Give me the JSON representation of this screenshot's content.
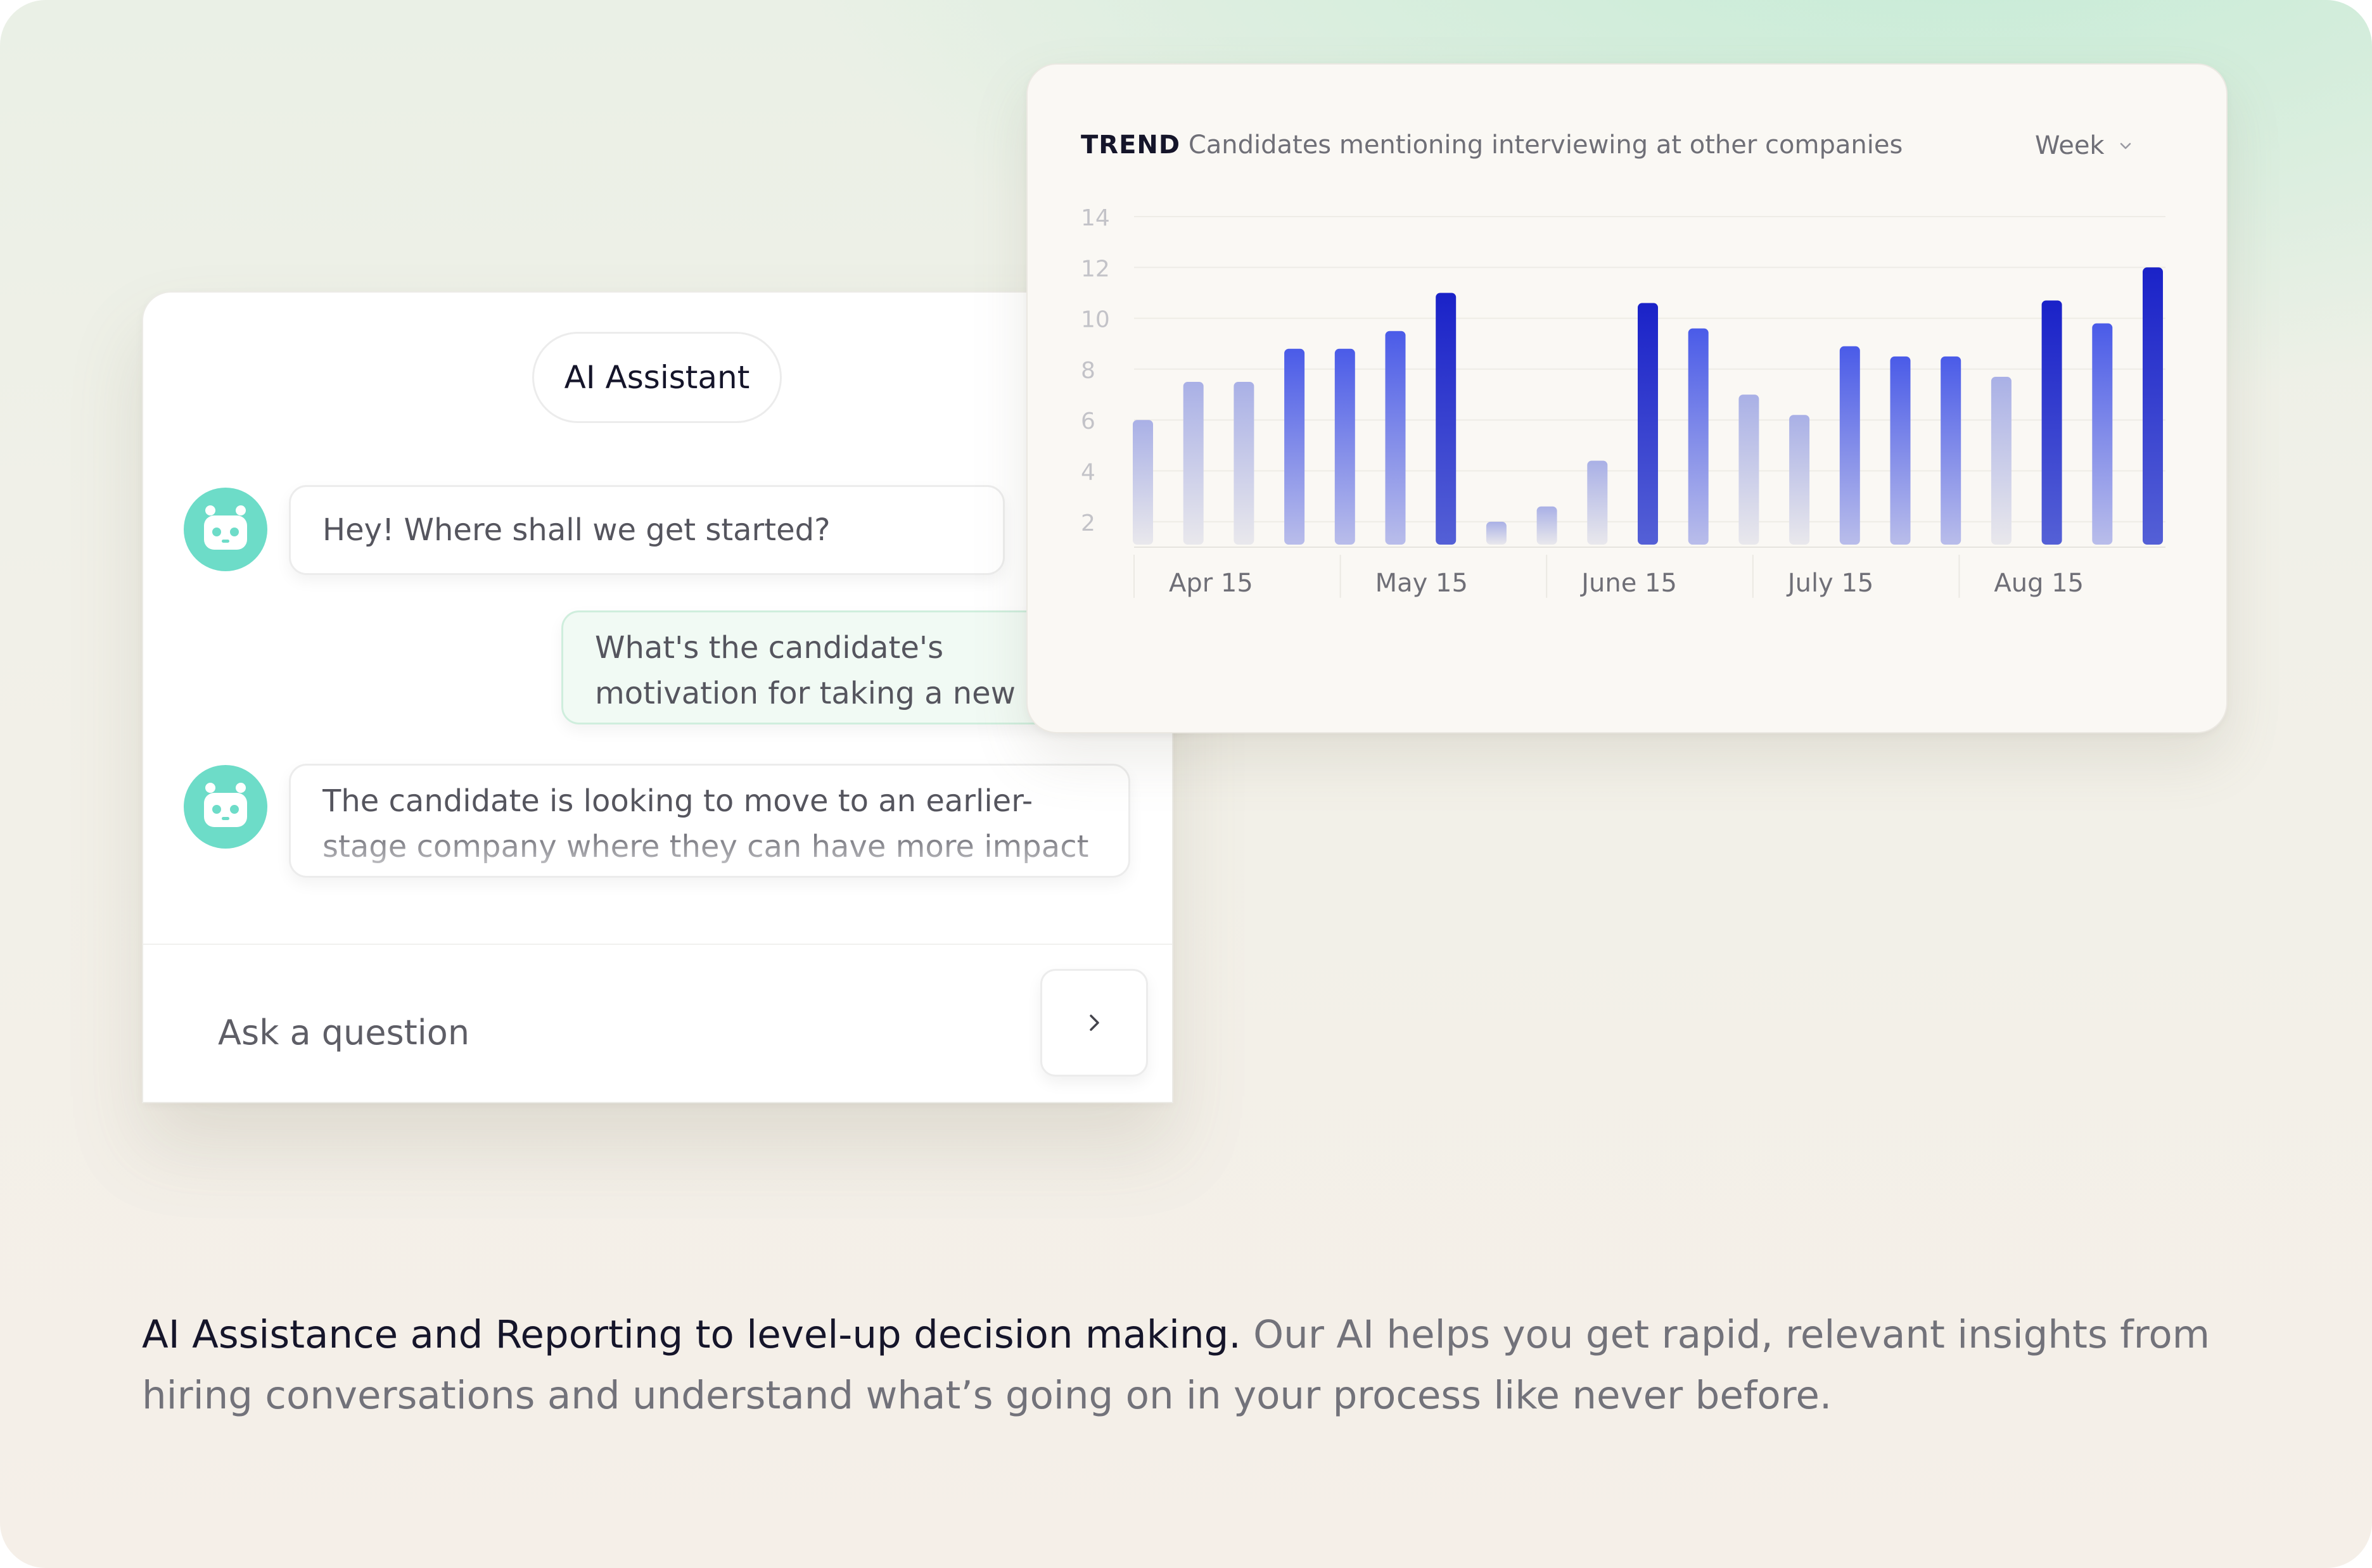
{
  "chat": {
    "title": "AI Assistant",
    "messages": [
      {
        "role": "assistant",
        "text": "Hey! Where shall we get started?"
      },
      {
        "role": "user",
        "line1": "What's the candidate's",
        "line2": "motivation for taking a new r"
      },
      {
        "role": "assistant",
        "line1": "The candidate is looking to move to an earlier-",
        "line2": "stage company where they can have more impact"
      }
    ],
    "input_placeholder": "Ask a question",
    "avatar_icon": "robot-icon",
    "send_icon": "chevron-right-icon"
  },
  "trend": {
    "label": "TREND",
    "title": "Candidates mentioning interviewing at other companies",
    "period": "Week",
    "period_icon": "chevron-down-icon"
  },
  "chart_data": {
    "type": "bar",
    "title": "Candidates mentioning interviewing at other companies",
    "xlabel": "",
    "ylabel": "",
    "ylim": [
      1,
      14
    ],
    "yticks": [
      2,
      4,
      6,
      8,
      10,
      12,
      14
    ],
    "xticks": [
      "Apr 15",
      "May 15",
      "June 15",
      "July 15",
      "Aug 15"
    ],
    "grid": true,
    "values": [
      6,
      7.5,
      7.5,
      8.8,
      8.8,
      9.5,
      11,
      2,
      2.6,
      4.4,
      10.6,
      9.6,
      7,
      6.2,
      8.9,
      8.5,
      8.5,
      7.7,
      10.7,
      9.8,
      12
    ]
  },
  "caption": {
    "lead": "AI Assistance and Reporting to level-up decision making.",
    "body": " Our AI helps you get rapid, relevant insights from hiring conversations and understand what’s going on in your process like never before."
  },
  "colors": {
    "accent_teal": "#6ddcc8",
    "bar_dark": "#1a22c8",
    "bar_mid": "#4a5be8",
    "bar_light": "#a9b0e6"
  }
}
